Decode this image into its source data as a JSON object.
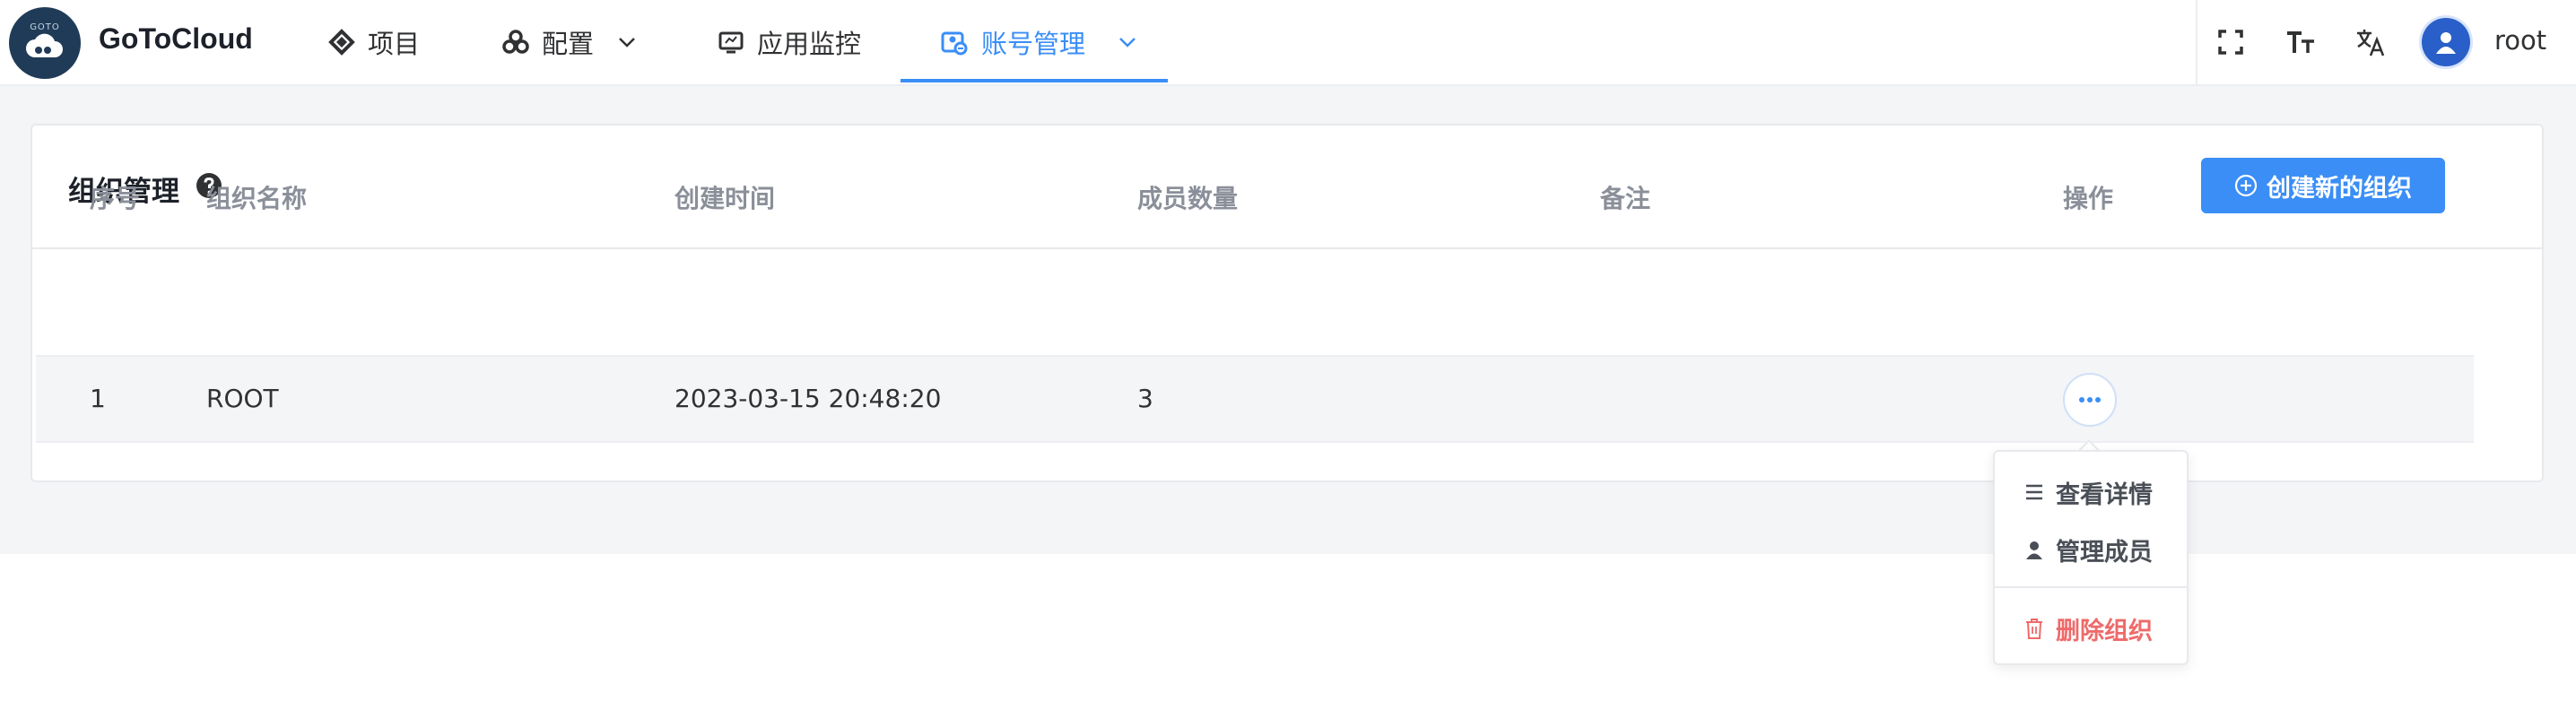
{
  "header": {
    "logo_text": "GOTO",
    "brand": "GoToCloud",
    "nav": [
      {
        "label": "项目",
        "icon": "project-icon"
      },
      {
        "label": "配置",
        "icon": "config-icon",
        "has_dropdown": true
      },
      {
        "label": "应用监控",
        "icon": "monitor-icon"
      },
      {
        "label": "账号管理",
        "icon": "account-icon",
        "has_dropdown": true,
        "active": true
      }
    ],
    "tools": [
      "fullscreen-icon",
      "font-size-icon",
      "translate-icon"
    ],
    "username": "root"
  },
  "card": {
    "title": "组织管理",
    "create_button": "创建新的组织"
  },
  "table": {
    "columns": [
      "序号",
      "组织名称",
      "创建时间",
      "成员数量",
      "备注",
      "操作"
    ],
    "rows": [
      {
        "index": "1",
        "name": "ROOT",
        "created": "2023-03-15 20:48:20",
        "members": "3",
        "note": ""
      }
    ]
  },
  "dropdown": {
    "items": [
      "查看详情",
      "管理成员",
      "删除组织"
    ]
  },
  "colors": {
    "accent": "#3a8ef6",
    "danger": "#ef6a6a",
    "logo_bg": "#1f3b57"
  }
}
